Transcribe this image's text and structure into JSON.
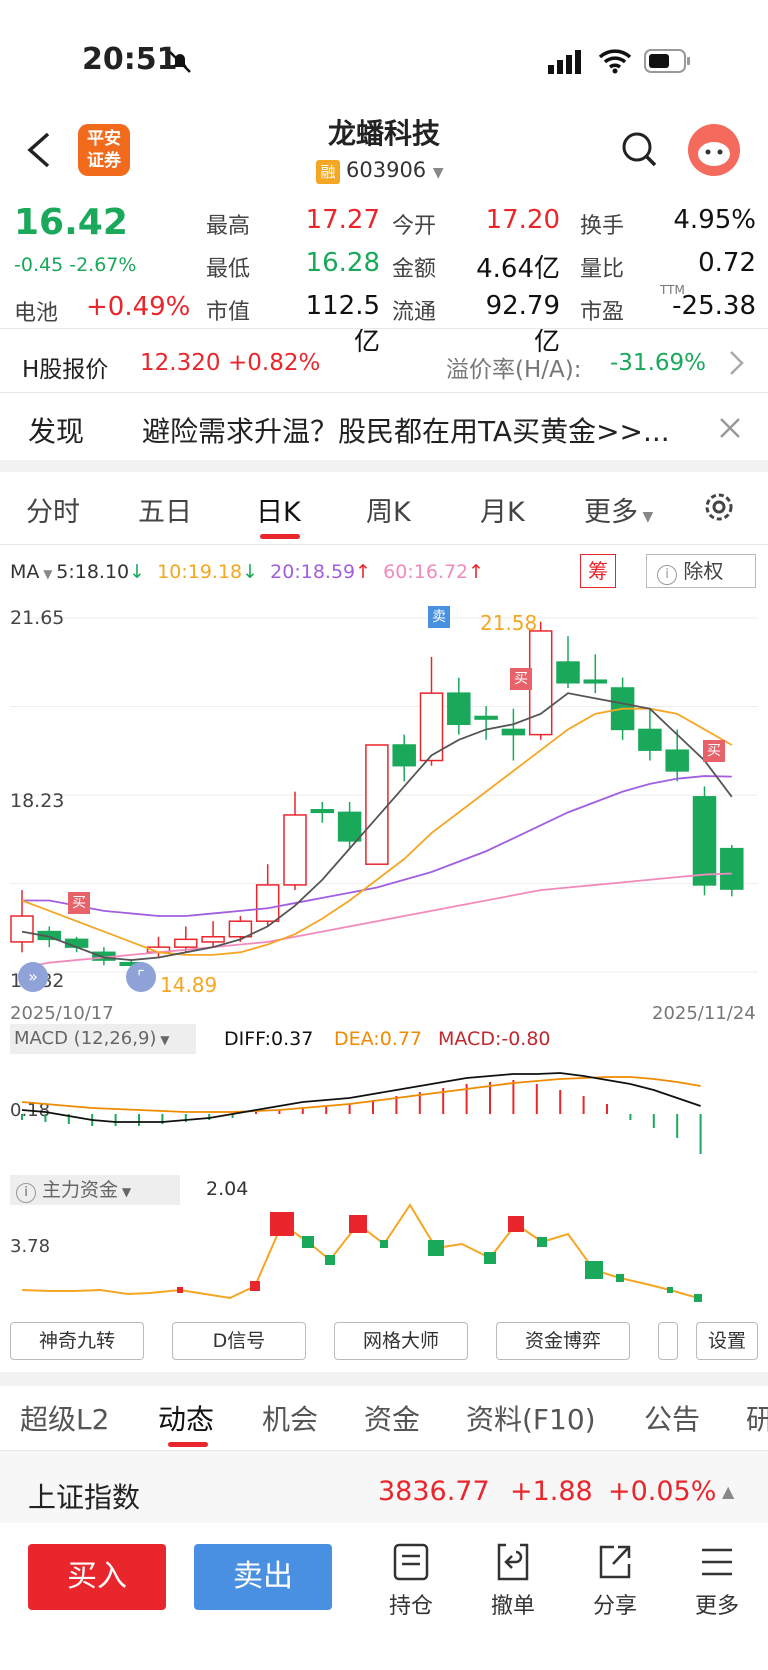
{
  "status": {
    "time": "20:51"
  },
  "header": {
    "title": "龙蟠科技",
    "logo_l1": "平安",
    "logo_l2": "证券",
    "rong": "融",
    "code": "603906"
  },
  "quote": {
    "price": "16.42",
    "change": "-0.45",
    "change_pct": "-2.67%",
    "battery_label": "电池",
    "battery_val": "+0.49%",
    "stats": [
      {
        "label": "最高",
        "value": "17.27",
        "color": "red"
      },
      {
        "label": "今开",
        "value": "17.20",
        "color": "red"
      },
      {
        "label": "换手",
        "value": "4.95%",
        "color": "black"
      },
      {
        "label": "最低",
        "value": "16.28",
        "color": "green"
      },
      {
        "label": "金额",
        "value": "4.64亿",
        "color": "black"
      },
      {
        "label": "量比",
        "value": "0.72",
        "color": "black"
      },
      {
        "label": "市值",
        "value": "112.5亿",
        "color": "black"
      },
      {
        "label": "流通",
        "value": "92.79亿",
        "color": "black"
      },
      {
        "label": "市盈",
        "value": "-25.38",
        "color": "black"
      }
    ],
    "ttm": "TTM"
  },
  "hshare": {
    "label": "H股报价",
    "price": "12.320",
    "pct": "+0.82%",
    "premium_label": "溢价率(H/A):",
    "premium": "-31.69%"
  },
  "discover": {
    "label": "发现",
    "text": "避险需求升温？股民都在用TA买黄金>>..."
  },
  "kline_tabs": [
    "分时",
    "五日",
    "日K",
    "周K",
    "月K",
    "更多"
  ],
  "ma": {
    "label": "MA",
    "ma5": "5:18.10",
    "ma10": "10:19.18",
    "ma20": "20:18.59",
    "ma60": "60:16.72",
    "chip": "筹",
    "fq": "除权"
  },
  "colors": {
    "red": "#e8262c",
    "green": "#1aa95b",
    "ma5": "#555555",
    "ma10": "#f5a623",
    "ma20": "#a15fe0",
    "ma60": "#f28bbd"
  },
  "chart_data": {
    "type": "candlestick",
    "price_labels": {
      "top": "21.65",
      "mid": "18.23",
      "bottom": "14.82",
      "high_mark": "21.58",
      "low_mark": "14.89"
    },
    "dates": {
      "start": "2025/10/17",
      "end": "2025/11/24"
    },
    "ylim": [
      14.82,
      21.65
    ],
    "candles": [
      {
        "o": 15.4,
        "c": 15.9,
        "h": 16.4,
        "l": 15.2
      },
      {
        "o": 15.6,
        "c": 15.45,
        "h": 15.7,
        "l": 15.3
      },
      {
        "o": 15.45,
        "c": 15.3,
        "h": 15.5,
        "l": 15.2
      },
      {
        "o": 15.2,
        "c": 15.05,
        "h": 15.3,
        "l": 14.95
      },
      {
        "o": 15.0,
        "c": 14.95,
        "h": 15.05,
        "l": 14.89
      },
      {
        "o": 15.2,
        "c": 15.3,
        "h": 15.5,
        "l": 15.1
      },
      {
        "o": 15.3,
        "c": 15.45,
        "h": 15.7,
        "l": 15.2
      },
      {
        "o": 15.4,
        "c": 15.5,
        "h": 15.8,
        "l": 15.3
      },
      {
        "o": 15.5,
        "c": 15.8,
        "h": 15.9,
        "l": 15.4
      },
      {
        "o": 15.8,
        "c": 16.5,
        "h": 16.9,
        "l": 15.7
      },
      {
        "o": 16.5,
        "c": 17.85,
        "h": 18.3,
        "l": 16.4
      },
      {
        "o": 17.95,
        "c": 17.9,
        "h": 18.1,
        "l": 17.7
      },
      {
        "o": 17.9,
        "c": 17.35,
        "h": 18.1,
        "l": 17.2
      },
      {
        "o": 16.9,
        "c": 19.2,
        "h": 19.2,
        "l": 16.9
      },
      {
        "o": 19.2,
        "c": 18.8,
        "h": 19.4,
        "l": 18.5
      },
      {
        "o": 18.9,
        "c": 20.2,
        "h": 20.9,
        "l": 18.8
      },
      {
        "o": 20.2,
        "c": 19.6,
        "h": 20.5,
        "l": 19.4
      },
      {
        "o": 19.75,
        "c": 19.7,
        "h": 19.95,
        "l": 19.3
      },
      {
        "o": 19.5,
        "c": 19.4,
        "h": 19.9,
        "l": 18.9
      },
      {
        "o": 19.4,
        "c": 21.4,
        "h": 21.58,
        "l": 19.3
      },
      {
        "o": 20.8,
        "c": 20.4,
        "h": 21.3,
        "l": 20.3
      },
      {
        "o": 20.45,
        "c": 20.4,
        "h": 20.95,
        "l": 20.2
      },
      {
        "o": 20.3,
        "c": 19.5,
        "h": 20.5,
        "l": 19.3
      },
      {
        "o": 19.5,
        "c": 19.1,
        "h": 19.9,
        "l": 18.9
      },
      {
        "o": 19.1,
        "c": 18.7,
        "h": 19.5,
        "l": 18.5
      },
      {
        "o": 18.2,
        "c": 16.5,
        "h": 18.4,
        "l": 16.3
      },
      {
        "o": 17.2,
        "c": 16.42,
        "h": 17.27,
        "l": 16.28
      }
    ],
    "ma5": [
      15.6,
      15.5,
      15.3,
      15.1,
      15.05,
      15.1,
      15.2,
      15.3,
      15.45,
      15.7,
      16.1,
      16.6,
      17.2,
      17.8,
      18.4,
      19.0,
      19.3,
      19.5,
      19.6,
      19.8,
      20.2,
      20.1,
      20.0,
      19.9,
      19.4,
      18.9,
      18.2
    ],
    "ma10": [
      16.2,
      16.0,
      15.8,
      15.6,
      15.4,
      15.2,
      15.15,
      15.15,
      15.2,
      15.35,
      15.55,
      15.85,
      16.2,
      16.6,
      17.0,
      17.5,
      17.9,
      18.3,
      18.7,
      19.1,
      19.5,
      19.8,
      19.9,
      19.9,
      19.8,
      19.5,
      19.2
    ],
    "ma20": [
      16.2,
      16.2,
      16.1,
      16.0,
      15.95,
      15.9,
      15.9,
      15.95,
      16.0,
      16.05,
      16.15,
      16.25,
      16.35,
      16.45,
      16.6,
      16.75,
      16.95,
      17.15,
      17.4,
      17.65,
      17.9,
      18.1,
      18.3,
      18.45,
      18.55,
      18.6,
      18.59
    ],
    "ma60": [
      14.9,
      15.0,
      15.05,
      15.1,
      15.15,
      15.2,
      15.25,
      15.3,
      15.35,
      15.4,
      15.5,
      15.6,
      15.7,
      15.8,
      15.9,
      16.0,
      16.1,
      16.2,
      16.3,
      16.4,
      16.45,
      16.5,
      16.55,
      16.6,
      16.65,
      16.7,
      16.72
    ]
  },
  "macd": {
    "label": "MACD (12,26,9)",
    "diff": "DIFF:0.37",
    "dea": "DEA:0.77",
    "macd": "MACD:-0.80",
    "axis": "0.18"
  },
  "flow": {
    "label": "主力资金",
    "value": "2.04",
    "axis": "3.78"
  },
  "tools": [
    "神奇九转",
    "D信号",
    "网格大师",
    "资金博弈",
    "设置"
  ],
  "section_tabs": [
    "超级L2",
    "动态",
    "机会",
    "资金",
    "资料(F10)",
    "公告",
    "研"
  ],
  "index": {
    "name": "上证指数",
    "price": "3836.77",
    "chg": "+1.88",
    "pct": "+0.05%"
  },
  "bottom": {
    "buy": "买入",
    "sell": "卖出",
    "icons": [
      "持仓",
      "撤单",
      "分享",
      "更多"
    ]
  },
  "markers": {
    "sell": "卖",
    "buy": "买"
  }
}
